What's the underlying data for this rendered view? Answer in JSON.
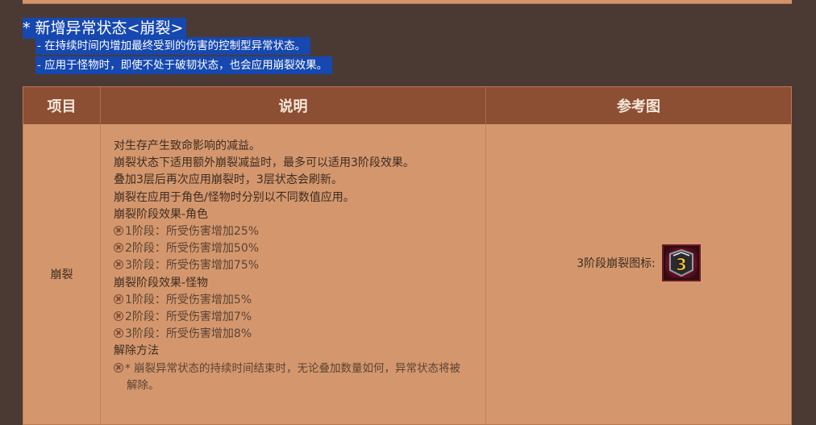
{
  "notes": {
    "title": "* 新增异常状态<崩裂>",
    "lines": [
      "- 在持续时间内增加最终受到的伤害的控制型异常状态。",
      "- 应用于怪物时，即使不处于破韧状态，也会应用崩裂效果。"
    ]
  },
  "table": {
    "headers": [
      "项目",
      "说明",
      "参考图"
    ],
    "row": {
      "item": "崩裂",
      "description": [
        "对生存产生致命影响的减益。",
        "崩裂状态下适用额外崩裂减益时，最多可以适用3阶段效果。",
        "叠加3层后再次应用崩裂时，3层状态会刷新。",
        "崩裂在应用于角色/怪物时分别以不同数值应用。"
      ],
      "character_title": "崩裂阶段效果-角色",
      "character_stages": [
        "1阶段：所受伤害增加25%",
        "2阶段：所受伤害增加50%",
        "3阶段：所受伤害增加75%"
      ],
      "monster_title": "崩裂阶段效果-怪物",
      "monster_stages": [
        "1阶段：所受伤害增加5%",
        "2阶段：所受伤害增加7%",
        "3阶段：所受伤害增加8%"
      ],
      "remove_title": "解除方法",
      "remove_text_1": "* 崩裂异常状态的持续时间结束时，无论叠加数量如何，异常状态将被",
      "remove_text_2": "解除。",
      "ref_label": "3阶段崩裂图标:",
      "icon_name": "stage-3-rupture-icon",
      "icon_glyph": "3"
    }
  }
}
